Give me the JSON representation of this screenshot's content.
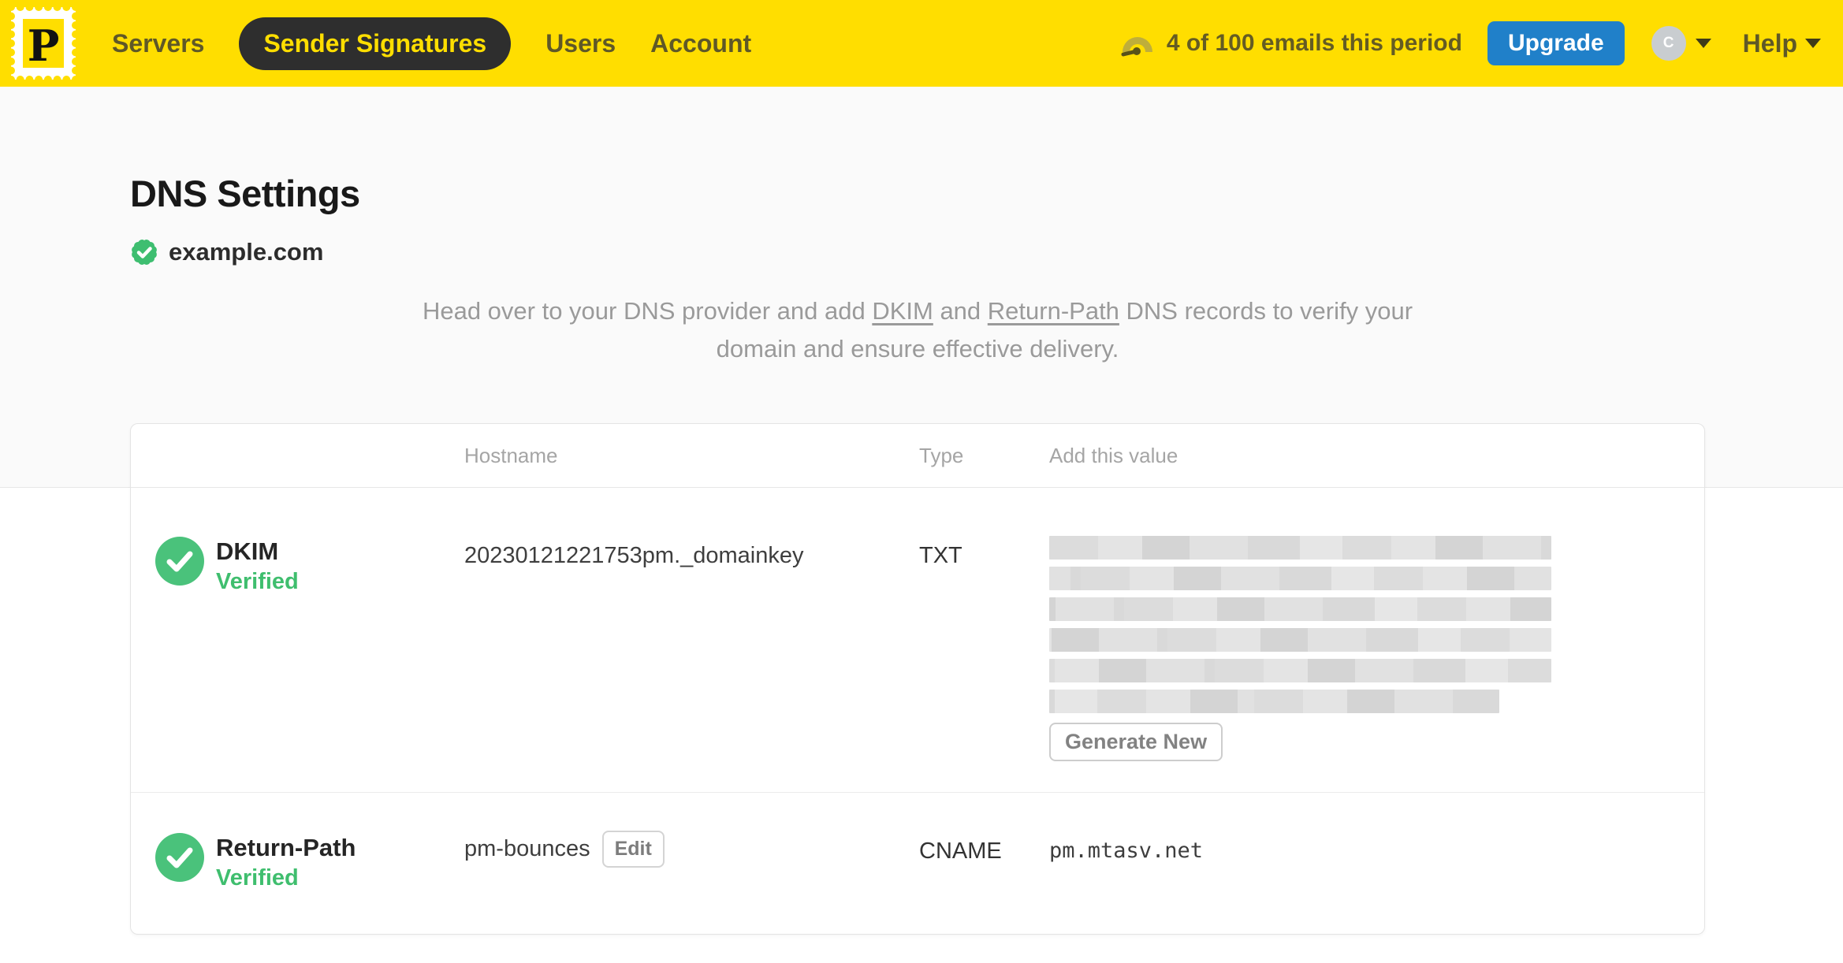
{
  "nav": {
    "logo_letter": "P",
    "items": [
      {
        "label": "Servers",
        "active": false
      },
      {
        "label": "Sender Signatures",
        "active": true
      },
      {
        "label": "Users",
        "active": false
      },
      {
        "label": "Account",
        "active": false
      }
    ],
    "usage_text": "4 of 100 emails this period",
    "upgrade_label": "Upgrade",
    "avatar_initial": "C",
    "help_label": "Help"
  },
  "page": {
    "title": "DNS Settings",
    "domain": "example.com",
    "description": {
      "pre": "Head over to your DNS provider and add ",
      "link1": "DKIM",
      "mid": " and ",
      "link2": "Return-Path",
      "post": " DNS records to verify your domain and ensure effective delivery."
    }
  },
  "table": {
    "headers": {
      "hostname": "Hostname",
      "type": "Type",
      "value": "Add this value"
    },
    "rows": [
      {
        "name": "DKIM",
        "status": "Verified",
        "hostname": "20230121221753pm._domainkey",
        "type": "TXT",
        "value": "[redacted]",
        "action_label": "Generate New"
      },
      {
        "name": "Return-Path",
        "status": "Verified",
        "hostname": "pm-bounces",
        "edit_label": "Edit",
        "type": "CNAME",
        "value": "pm.mtasv.net"
      }
    ]
  },
  "colors": {
    "brand_yellow": "#FFDE00",
    "nav_active_pill": "#2e2e2e",
    "upgrade_blue": "#2080C9",
    "success_green": "#3FBE6E"
  }
}
